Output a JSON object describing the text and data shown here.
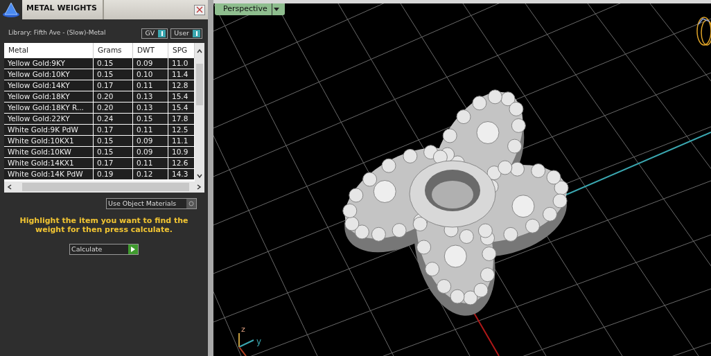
{
  "panel": {
    "title": "METAL WEIGHTS",
    "library": "Library: Fifth Ave - (Slow)-Metal",
    "toggles": [
      {
        "label": "GV",
        "on": true
      },
      {
        "label": "User",
        "on": true
      }
    ],
    "table": {
      "columns": [
        "Metal",
        "Grams",
        "DWT",
        "SPG"
      ],
      "rows": [
        [
          "Yellow Gold:9KY",
          "0.15",
          "0.09",
          "11.0"
        ],
        [
          "Yellow Gold:10KY",
          "0.15",
          "0.10",
          "11.4"
        ],
        [
          "Yellow Gold:14KY",
          "0.17",
          "0.11",
          "12.8"
        ],
        [
          "Yellow Gold:18KY",
          "0.20",
          "0.13",
          "15.4"
        ],
        [
          "Yellow Gold:18KY R...",
          "0.20",
          "0.13",
          "15.4"
        ],
        [
          "Yellow Gold:22KY",
          "0.24",
          "0.15",
          "17.8"
        ],
        [
          "White Gold:9K PdW",
          "0.17",
          "0.11",
          "12.5"
        ],
        [
          "White Gold:10KX1",
          "0.15",
          "0.09",
          "11.1"
        ],
        [
          "White Gold:10KW",
          "0.15",
          "0.09",
          "10.9"
        ],
        [
          "White Gold:14KX1",
          "0.17",
          "0.11",
          "12.6"
        ],
        [
          "White Gold:14K PdW",
          "0.19",
          "0.12",
          "14.3"
        ]
      ]
    },
    "option": {
      "label": "Use Object Materials"
    },
    "hint": "Highlight the item you want to find the weight for then press calculate.",
    "button": "Calculate"
  },
  "viewport": {
    "view_menu": "Perspective",
    "axes": [
      "z",
      "y"
    ]
  }
}
